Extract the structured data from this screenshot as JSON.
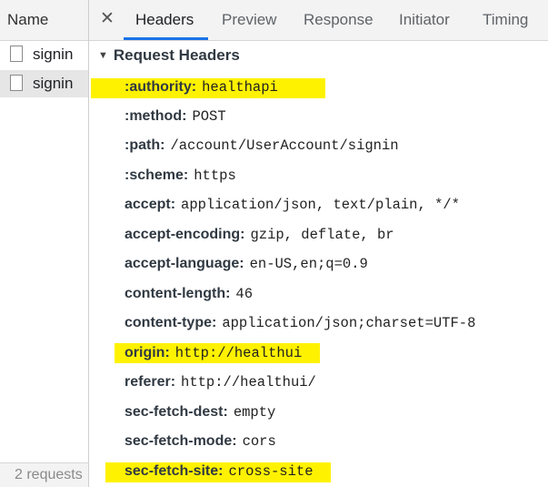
{
  "request_list": {
    "header": "Name",
    "items": [
      {
        "name": "signin",
        "selected": false
      },
      {
        "name": "signin",
        "selected": true
      }
    ],
    "footer": "2 requests"
  },
  "tabs": {
    "close_icon": "close-icon",
    "items": [
      "Headers",
      "Preview",
      "Response",
      "Initiator",
      "Timing"
    ],
    "active": "Headers",
    "accent_color": "#1a73e8"
  },
  "request_headers": {
    "title": "Request Headers",
    "highlight_color": "#fff200",
    "rows": [
      {
        "key": ":authority:",
        "value": "healthapi",
        "highlighted": true
      },
      {
        "key": ":method:",
        "value": "POST",
        "highlighted": false
      },
      {
        "key": ":path:",
        "value": "/account/UserAccount/signin",
        "highlighted": false
      },
      {
        "key": ":scheme:",
        "value": "https",
        "highlighted": false
      },
      {
        "key": "accept:",
        "value": "application/json, text/plain, */*",
        "highlighted": false
      },
      {
        "key": "accept-encoding:",
        "value": "gzip, deflate, br",
        "highlighted": false
      },
      {
        "key": "accept-language:",
        "value": "en-US,en;q=0.9",
        "highlighted": false
      },
      {
        "key": "content-length:",
        "value": "46",
        "highlighted": false
      },
      {
        "key": "content-type:",
        "value": "application/json;charset=UTF-8",
        "highlighted": false
      },
      {
        "key": "origin:",
        "value": "http://healthui",
        "highlighted": true
      },
      {
        "key": "referer:",
        "value": "http://healthui/",
        "highlighted": false
      },
      {
        "key": "sec-fetch-dest:",
        "value": "empty",
        "highlighted": false
      },
      {
        "key": "sec-fetch-mode:",
        "value": "cors",
        "highlighted": false
      },
      {
        "key": "sec-fetch-site:",
        "value": "cross-site",
        "highlighted": true
      }
    ]
  }
}
